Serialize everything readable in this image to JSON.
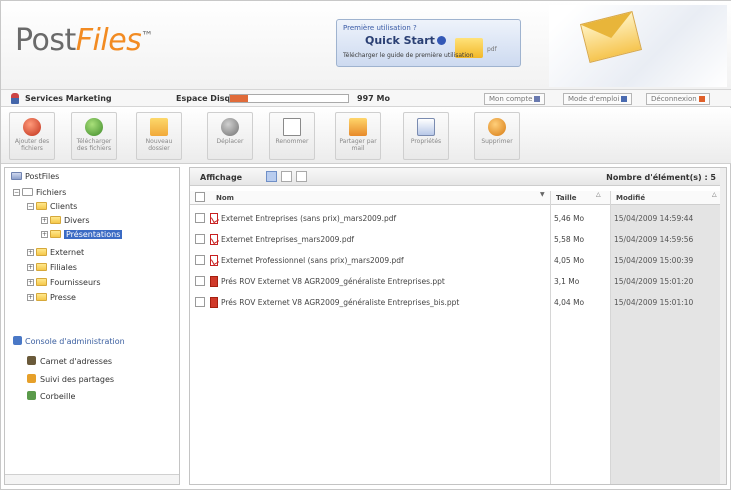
{
  "header": {
    "logo_part1": "Post",
    "logo_part2": "Files",
    "logo_tm": "™",
    "banner_line1": "Première utilisation ?",
    "banner_title": "Quick Start",
    "banner_line3": "Télécharger le guide de première utilisation",
    "banner_pdf": "pdf"
  },
  "status": {
    "service": "Services Marketing",
    "space_label": "Espace Disque",
    "space_value": "997 Mo",
    "space_used_fraction": 0.15,
    "account_buttons": [
      "Mon compte",
      "Mode d'emploi",
      "Déconnexion"
    ]
  },
  "toolbar": {
    "buttons": [
      {
        "label": "Ajouter des fichiers",
        "icon": "add-icon"
      },
      {
        "label": "Télécharger des fichiers",
        "icon": "download-icon"
      },
      {
        "label": "Nouveau dossier",
        "icon": "new-folder-icon"
      },
      {
        "label": "Déplacer",
        "icon": "move-icon"
      },
      {
        "label": "Renommer",
        "icon": "rename-icon"
      },
      {
        "label": "Partager par mail",
        "icon": "share-icon"
      },
      {
        "label": "Propriétés",
        "icon": "properties-icon"
      },
      {
        "label": "Supprimer",
        "icon": "delete-icon"
      }
    ]
  },
  "tree": {
    "root": "PostFiles",
    "items": [
      {
        "label": "Fichiers",
        "level": 1
      },
      {
        "label": "Clients",
        "level": 2
      },
      {
        "label": "Divers",
        "level": 3
      },
      {
        "label": "Présentations",
        "level": 3,
        "selected": true
      },
      {
        "label": "Externet",
        "level": 2
      },
      {
        "label": "Filiales",
        "level": 2
      },
      {
        "label": "Fournisseurs",
        "level": 2
      },
      {
        "label": "Presse",
        "level": 2
      }
    ]
  },
  "admin": {
    "title": "Console d'administration",
    "items": [
      "Carnet d'adresses",
      "Suivi des partages",
      "Corbeille"
    ]
  },
  "main": {
    "affichage": "Affichage",
    "count": "Nombre d'élément(s) : 5",
    "columns": {
      "name": "Nom",
      "size": "Taille",
      "date": "Modifié"
    },
    "files": [
      {
        "type": "pdf",
        "name": "Externet Entreprises (sans prix)_mars2009.pdf",
        "size": "5,46 Mo",
        "date": "15/04/2009 14:59:44"
      },
      {
        "type": "pdf",
        "name": "Externet Entreprises_mars2009.pdf",
        "size": "5,58 Mo",
        "date": "15/04/2009 14:59:56"
      },
      {
        "type": "pdf",
        "name": "Externet Professionnel (sans prix)_mars2009.pdf",
        "size": "4,05 Mo",
        "date": "15/04/2009 15:00:39"
      },
      {
        "type": "ppt",
        "name": "Prés ROV Externet V8 AGR2009_généraliste Entreprises.ppt",
        "size": "3,1 Mo",
        "date": "15/04/2009 15:01:20"
      },
      {
        "type": "ppt",
        "name": "Prés ROV Externet V8 AGR2009_généraliste Entreprises_bis.ppt",
        "size": "4,04 Mo",
        "date": "15/04/2009 15:01:10"
      }
    ]
  },
  "colors": {
    "accent": "#f28b22",
    "selection": "#3b6bc4"
  }
}
